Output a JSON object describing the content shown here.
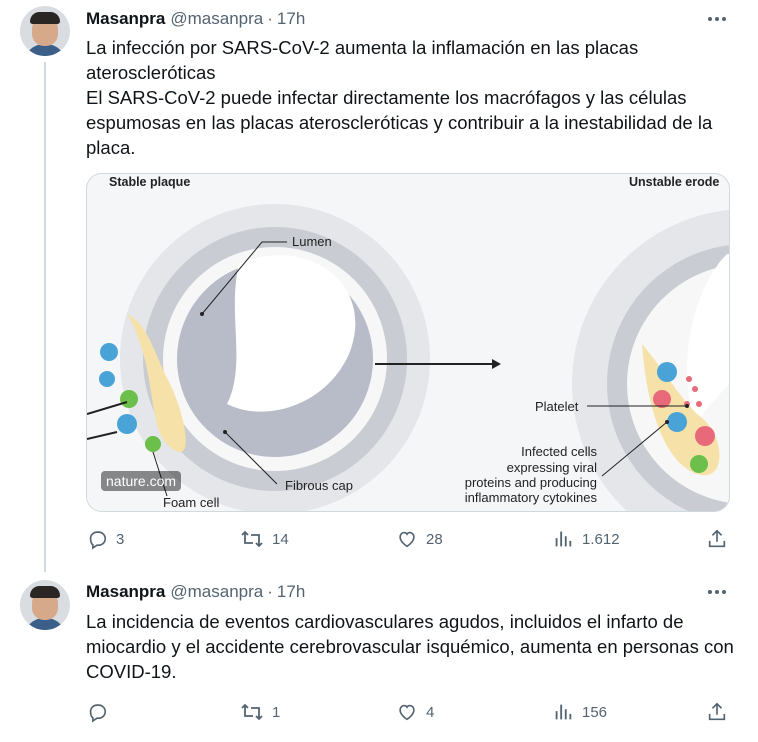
{
  "tweets": [
    {
      "author_name": "Masanpra",
      "handle": "@masanpra",
      "separator": "·",
      "time": "17h",
      "text_lines": [
        "La infección por SARS-CoV-2 aumenta la inflamación en las placas ateroscleróticas",
        "El SARS-CoV-2 puede infectar directamente los macrófagos y las células espumosas en las placas ateroscleróticas y contribuir a la inestabilidad de la placa."
      ],
      "media": {
        "labels": {
          "stable": "Stable plaque",
          "unstable": "Unstable erode",
          "lumen": "Lumen",
          "fibrous_cap": "Fibrous cap",
          "foam_cell": "Foam cell",
          "platelet": "Platelet",
          "infected_1": "Infected cells",
          "infected_2": "expressing viral",
          "infected_3": "proteins and producing",
          "infected_4": "inflammatory cytokines"
        },
        "watermark": "nature.com"
      },
      "actions": {
        "replies": "3",
        "retweets": "14",
        "likes": "28",
        "views": "1.612"
      }
    },
    {
      "author_name": "Masanpra",
      "handle": "@masanpra",
      "separator": "·",
      "time": "17h",
      "text_lines": [
        "La incidencia de eventos cardiovasculares agudos, incluidos el infarto de miocardio y el accidente cerebrovascular isquémico, aumenta en personas con COVID-19."
      ],
      "actions": {
        "replies": "",
        "retweets": "1",
        "likes": "4",
        "views": "156"
      }
    }
  ],
  "icons": {
    "more": "more-horizontal-icon",
    "reply": "reply-icon",
    "retweet": "retweet-icon",
    "like": "heart-icon",
    "views": "bar-chart-icon",
    "share": "share-icon"
  },
  "colors": {
    "text": "#0f1419",
    "secondary": "#536471",
    "border": "#cfd9de"
  }
}
